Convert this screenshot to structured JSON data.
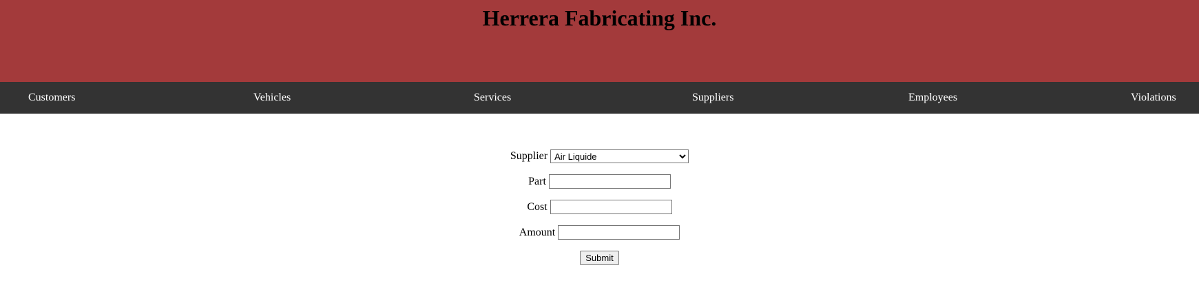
{
  "header": {
    "title": "Herrera Fabricating Inc."
  },
  "nav": {
    "items": [
      "Customers",
      "Vehicles",
      "Services",
      "Suppliers",
      "Employees",
      "Violations"
    ]
  },
  "form": {
    "supplier_label": "Supplier",
    "supplier_selected": "Air Liquide",
    "part_label": "Part",
    "part_value": "",
    "cost_label": "Cost",
    "cost_value": "",
    "amount_label": "Amount",
    "amount_value": "",
    "submit_label": "Submit"
  },
  "colors": {
    "header_bg": "#a33a3b",
    "nav_bg": "#333333",
    "nav_text": "#ffffff"
  }
}
